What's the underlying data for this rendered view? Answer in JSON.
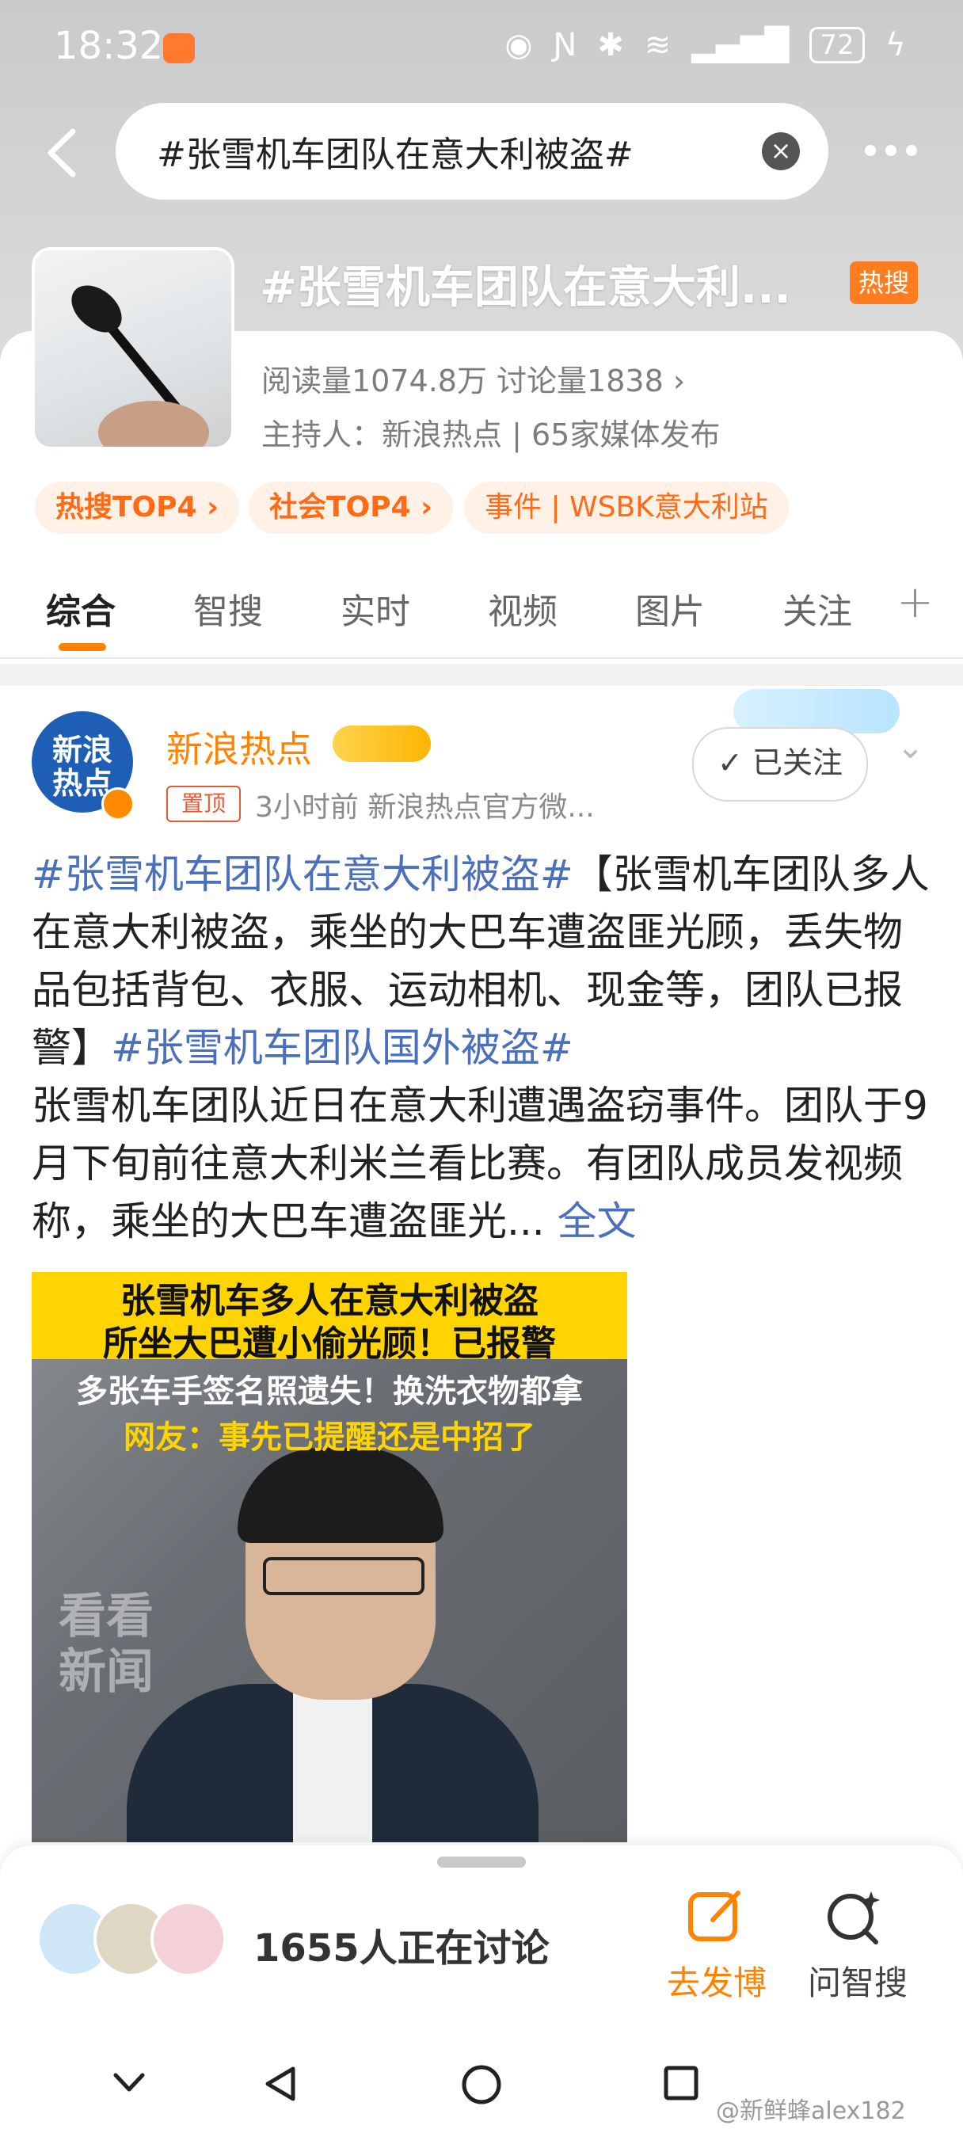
{
  "status_bar": {
    "time": "18:32",
    "battery": "72"
  },
  "search": {
    "query": "#张雪机车团队在意大利被盗#"
  },
  "topic": {
    "title": "#张雪机车团队在意大利...",
    "hot_tag": "热搜",
    "stats": "阅读量1074.8万  讨论量1838  ›",
    "host": "主持人：新浪热点 | 65家媒体发布",
    "pills": [
      "热搜TOP4 ›",
      "社会TOP4 ›",
      "事件 | WSBK意大利站"
    ]
  },
  "tabs": [
    "综合",
    "智搜",
    "实时",
    "视频",
    "图片",
    "关注"
  ],
  "post": {
    "avatar_text": "新浪热点",
    "author": "新浪热点",
    "pinned": "置顶",
    "meta": "3小时前  新浪热点官方微...",
    "follow_label": "✓ 已关注",
    "text_link1": "#张雪机车团队在意大利被盗#",
    "text_body1": "【张雪机车团队多人在意大利被盗，乘坐的大巴车遭盗匪光顾，丢失物品包括背包、衣服、运动相机、现金等，团队已报警】",
    "text_link2": "#张雪机车团队国外被盗#",
    "text_body2": "张雪机车团队近日在意大利遭遇盗窃事件。团队于9月下旬前往意大利米兰看比赛。有团队成员发视频称，乘坐的大巴车遭盗匪光...",
    "text_more": " 全文",
    "image_captions": [
      "张雪机车多人在意大利被盗",
      "所坐大巴遭小偷光顾！已报警",
      "多张车手签名照遗失！换洗衣物都拿",
      "网友：事先已提醒还是中招了"
    ],
    "image_watermark": "看看新闻"
  },
  "bottom": {
    "discuss": "1655人正在讨论",
    "post_label": "去发博",
    "ask_label": "问智搜"
  },
  "credit": "@新鲜蜂alex182",
  "colors": {
    "accent": "#ff8200",
    "link": "#4a6fbc",
    "hot": "#ff7d1f"
  }
}
